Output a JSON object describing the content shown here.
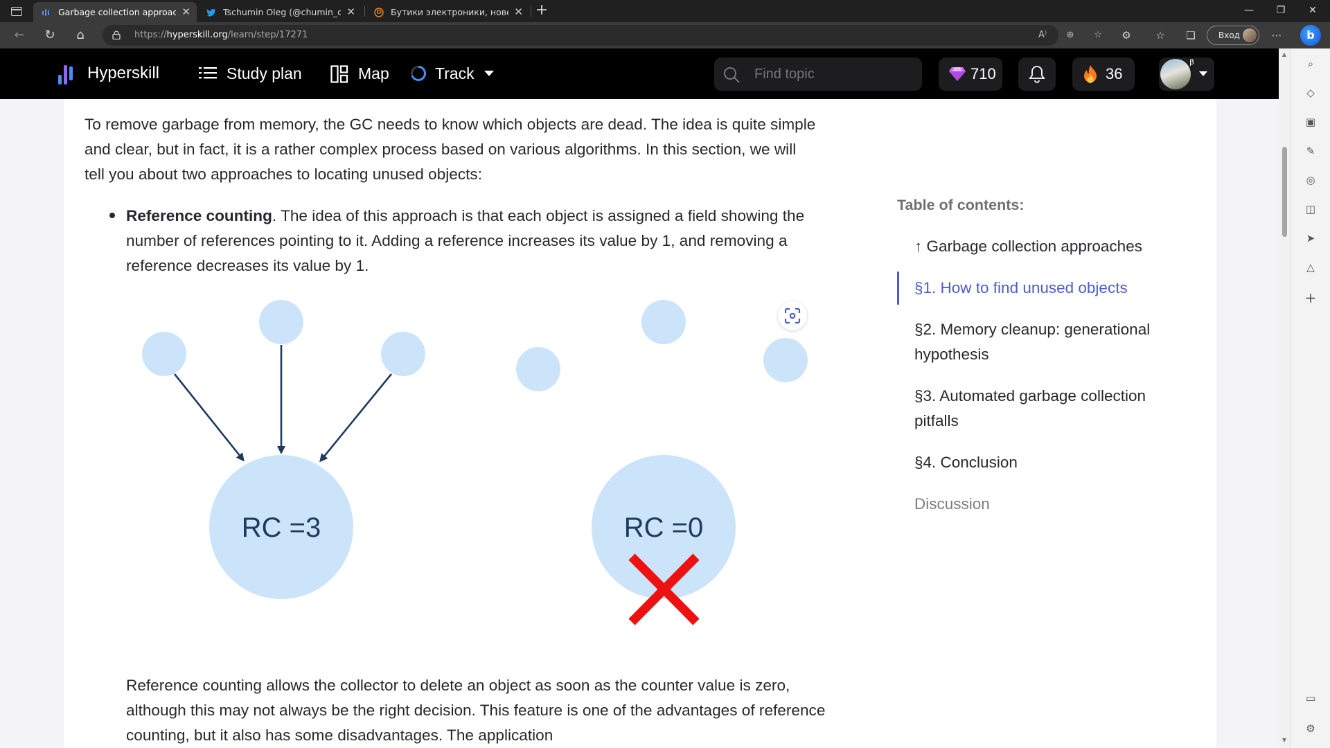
{
  "browser": {
    "tabs": [
      {
        "title": "Garbage collection approaches -",
        "active": true,
        "favicon": "hyperskill-icon"
      },
      {
        "title": "Tschumin Oleg (@chumin_oleg)",
        "active": false,
        "favicon": "twitter-icon"
      },
      {
        "title": "Бутики электроники, новейших",
        "active": false,
        "favicon": "store-icon"
      }
    ],
    "url_prefix": "https://",
    "url_host": "hyperskill.org",
    "url_path": "/learn/step/17271",
    "signin_label": "Вход"
  },
  "header": {
    "brand": "Hyperskill",
    "nav": {
      "study_plan": "Study plan",
      "map": "Map",
      "track": "Track"
    },
    "search_placeholder": "Find topic",
    "gems": "710",
    "streak": "36",
    "beta_badge": "β"
  },
  "article": {
    "intro": "To remove garbage from memory, the GC needs to know which objects are dead. The idea is quite simple and clear, but in fact, it is a rather complex process based on various algorithms. In this section, we will tell you about two approaches to locating unused objects:",
    "bullet_term": "Reference counting",
    "bullet_text": ". The idea of this approach is that each object is assigned a field showing the number of references pointing to it. Adding a reference increases its value by 1, and removing a reference decreases its value by 1.",
    "after_diagram": "Reference counting allows the collector to delete an object as soon as the counter value is zero, although this may not always be the right decision. This feature is one of the advantages of reference counting, but it also has some disadvantages. The application",
    "diagram": {
      "left_label": "RC =3",
      "right_label": "RC =0"
    }
  },
  "toc": {
    "title": "Table of contents:",
    "items": [
      {
        "label": "↑ Garbage collection approaches",
        "state": "normal"
      },
      {
        "label": "§1. How to find unused objects",
        "state": "active"
      },
      {
        "label": "§2. Memory cleanup: generational hypothesis",
        "state": "normal"
      },
      {
        "label": "§3. Automated garbage collection pitfalls",
        "state": "normal"
      },
      {
        "label": "§4. Conclusion",
        "state": "normal"
      },
      {
        "label": "Discussion",
        "state": "muted"
      }
    ]
  },
  "colors": {
    "accent": "#4c5bd4",
    "circle_fill": "#cce4fa",
    "arrow": "#1f3a5c",
    "cross": "#ee1111"
  }
}
